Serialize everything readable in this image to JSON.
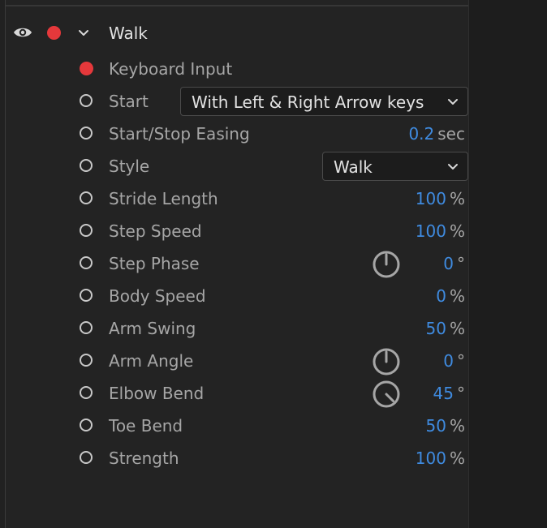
{
  "group": {
    "title": "Walk"
  },
  "params": {
    "keyboard_input": {
      "label": "Keyboard Input"
    },
    "start": {
      "label": "Start",
      "dropdown_value": "With Left & Right Arrow keys"
    },
    "start_stop_easing": {
      "label": "Start/Stop Easing",
      "value": "0.2",
      "unit": "sec"
    },
    "style": {
      "label": "Style",
      "dropdown_value": "Walk"
    },
    "stride_length": {
      "label": "Stride Length",
      "value": "100",
      "unit": "%"
    },
    "step_speed": {
      "label": "Step Speed",
      "value": "100",
      "unit": "%"
    },
    "step_phase": {
      "label": "Step Phase",
      "value": "0",
      "unit": "°",
      "dial_angle_deg": 0
    },
    "body_speed": {
      "label": "Body Speed",
      "value": "0",
      "unit": "%"
    },
    "arm_swing": {
      "label": "Arm Swing",
      "value": "50",
      "unit": "%"
    },
    "arm_angle": {
      "label": "Arm Angle",
      "value": "0",
      "unit": "°",
      "dial_angle_deg": 0
    },
    "elbow_bend": {
      "label": "Elbow Bend",
      "value": "45",
      "unit": "°",
      "dial_angle_deg": 45
    },
    "toe_bend": {
      "label": "Toe Bend",
      "value": "50",
      "unit": "%"
    },
    "strength": {
      "label": "Strength",
      "value": "100",
      "unit": "%"
    }
  },
  "icons": {
    "visibility": "eye-icon",
    "record": "record-dot-icon",
    "collapse": "chevron-down-icon",
    "keyframe": "keyframe-toggle-icon",
    "dial": "rotation-dial-icon"
  },
  "colors": {
    "value_blue": "#3f8be0",
    "record_red": "#e5383b",
    "label_gray": "#a6a6a6",
    "title_white": "#e2e2e2",
    "panel_bg": "#232323"
  }
}
